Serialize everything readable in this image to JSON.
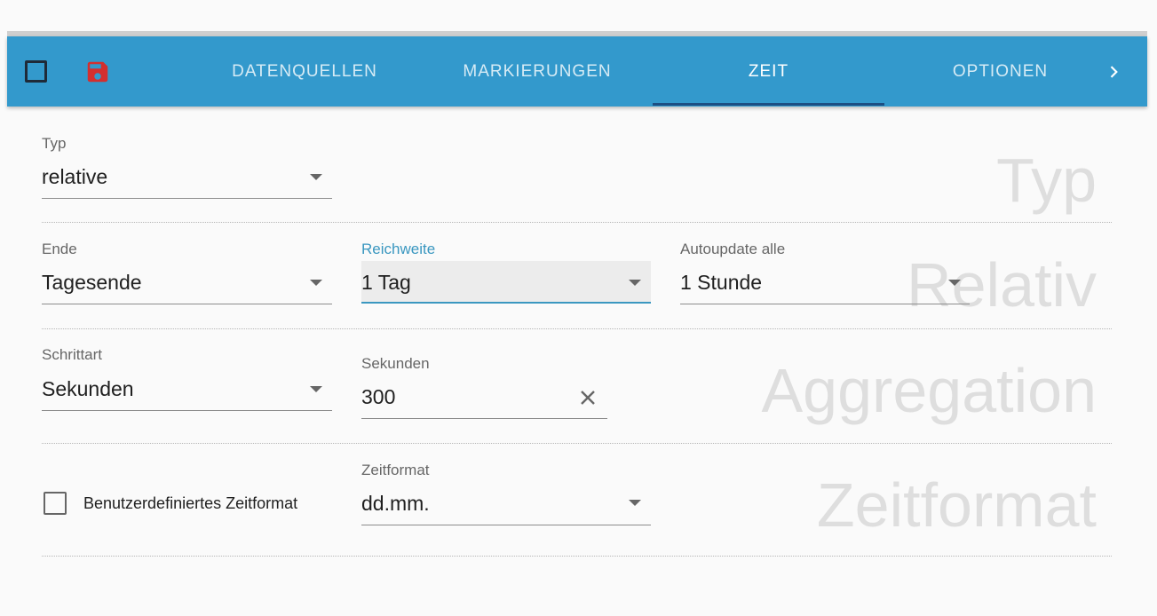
{
  "toolbar": {
    "checkbox_icon": "checkbox-outline-icon",
    "save_icon": "floppy-disk-icon",
    "next_icon": "chevron-right-icon",
    "tabs": [
      {
        "label": "DATENQUELLEN",
        "active": false
      },
      {
        "label": "MARKIERUNGEN",
        "active": false
      },
      {
        "label": "ZEIT",
        "active": true
      },
      {
        "label": "OPTIONEN",
        "active": false
      }
    ],
    "colors": {
      "bar": "#3399cc",
      "indicator": "#1d4e82",
      "save": "#d32f2f"
    }
  },
  "sections": {
    "typ": "Typ",
    "relativ": "Relativ",
    "aggregation": "Aggregation",
    "zeitformat": "Zeitformat"
  },
  "fields": {
    "typ": {
      "label": "Typ",
      "value": "relative"
    },
    "ende": {
      "label": "Ende",
      "value": "Tagesende"
    },
    "reichweite": {
      "label": "Reichweite",
      "value": "1 Tag"
    },
    "autoupdate": {
      "label": "Autoupdate alle",
      "value": "1 Stunde"
    },
    "schrittart": {
      "label": "Schrittart",
      "value": "Sekunden"
    },
    "sekunden": {
      "label": "Sekunden",
      "value": "300"
    },
    "zeitformat": {
      "label": "Zeitformat",
      "value": "dd.mm."
    }
  },
  "custom_format_checkbox": {
    "label": "Benutzerdefiniertes Zeitformat",
    "checked": false
  }
}
